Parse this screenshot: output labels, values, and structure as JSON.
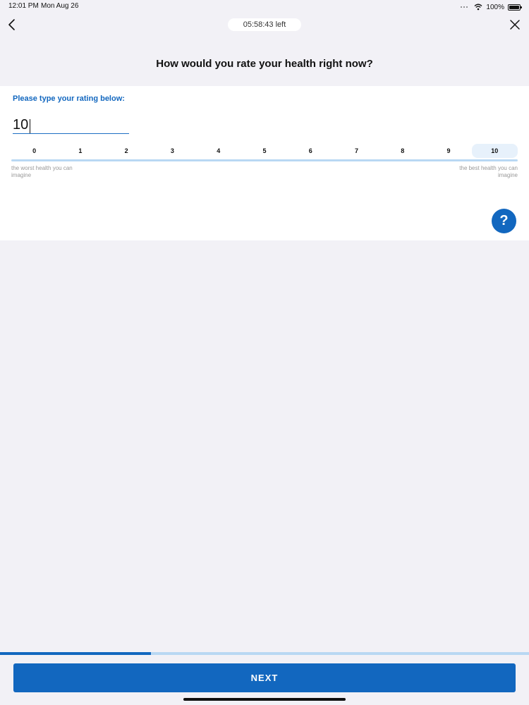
{
  "status_bar": {
    "time": "12:01 PM",
    "date": "Mon Aug 26",
    "battery": "100%"
  },
  "header": {
    "timer": "05:58:43 left",
    "question": "How would you rate your health right now?",
    "icons": {
      "back": "chevron-left-icon",
      "close": "close-icon"
    }
  },
  "form": {
    "prompt": "Please type your rating below:",
    "rating_value": "10",
    "scale": [
      "0",
      "1",
      "2",
      "3",
      "4",
      "5",
      "6",
      "7",
      "8",
      "9",
      "10"
    ],
    "selected_index": 10,
    "worst_label": "the worst health you can imagine",
    "best_label": "the best health you can imagine",
    "help_label": "?"
  },
  "footer": {
    "progress": 0.285,
    "next_label": "NEXT"
  },
  "colors": {
    "accent": "#1267bf",
    "accent_light": "#b9d8f3",
    "background": "#f2f1f6"
  }
}
